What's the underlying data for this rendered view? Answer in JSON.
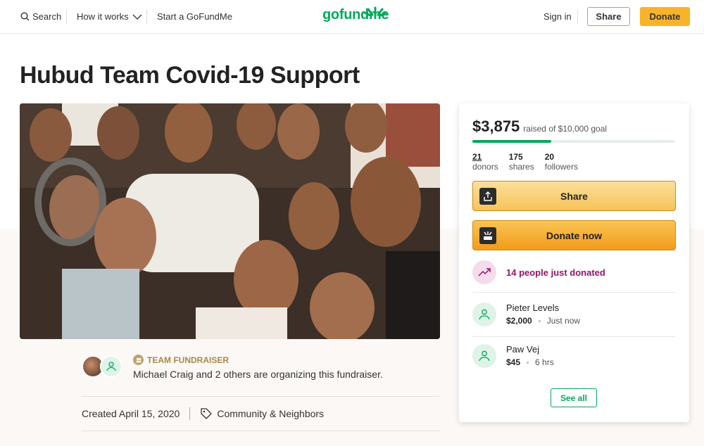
{
  "header": {
    "search_label": "Search",
    "how_it_works": "How it works",
    "start": "Start a GoFundMe",
    "logo_text": "gofundme",
    "sign_in": "Sign in",
    "share": "Share",
    "donate": "Donate"
  },
  "campaign": {
    "title": "Hubud Team Covid-19 Support",
    "team_label": "TEAM FUNDRAISER",
    "organizer_text": "Michael Craig and 2 others are organizing this fundraiser.",
    "created": "Created April 15, 2020",
    "category": "Community & Neighbors"
  },
  "progress": {
    "raised": "$3,875",
    "goal_text": "raised of $10,000 goal",
    "fraction": 0.3875,
    "stats": [
      {
        "value": "21",
        "label": "donors"
      },
      {
        "value": "175",
        "label": "shares"
      },
      {
        "value": "20",
        "label": "followers"
      }
    ]
  },
  "actions": {
    "share": "Share",
    "donate_now": "Donate now",
    "recent": "14 people just donated",
    "see_all": "See all"
  },
  "donations": [
    {
      "name": "Pieter Levels",
      "amount": "$2,000",
      "time": "Just now"
    },
    {
      "name": "Paw Vej",
      "amount": "$45",
      "time": "6 hrs"
    }
  ],
  "colors": {
    "brand_green": "#02a95c",
    "donate_orange": "#f6b42c",
    "recent_purple": "#8e1668"
  }
}
